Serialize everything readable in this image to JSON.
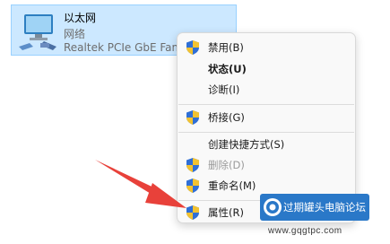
{
  "adapter": {
    "name": "以太网",
    "type": "网络",
    "device": "Realtek PCIe GbE Fam"
  },
  "menu": {
    "items": [
      {
        "label": "禁用(B)",
        "icon": "shield-icon",
        "bold": false,
        "disabled": false
      },
      {
        "label": "状态(U)",
        "icon": "",
        "bold": true,
        "disabled": false
      },
      {
        "label": "诊断(I)",
        "icon": "",
        "bold": false,
        "disabled": false
      },
      {
        "label": "桥接(G)",
        "icon": "shield-icon",
        "bold": false,
        "disabled": false
      },
      {
        "label": "创建快捷方式(S)",
        "icon": "",
        "bold": false,
        "disabled": false
      },
      {
        "label": "删除(D)",
        "icon": "shield-icon",
        "bold": false,
        "disabled": true
      },
      {
        "label": "重命名(M)",
        "icon": "shield-icon",
        "bold": false,
        "disabled": false
      },
      {
        "label": "属性(R)",
        "icon": "shield-icon",
        "bold": false,
        "disabled": false
      }
    ]
  },
  "watermark": {
    "text": "过期罐头电脑论坛",
    "url": "www.gqgtpc.com"
  },
  "colors": {
    "selection_bg": "#cce8ff",
    "arrow": "#e8413a",
    "watermark_bg": "#2a78c8"
  }
}
